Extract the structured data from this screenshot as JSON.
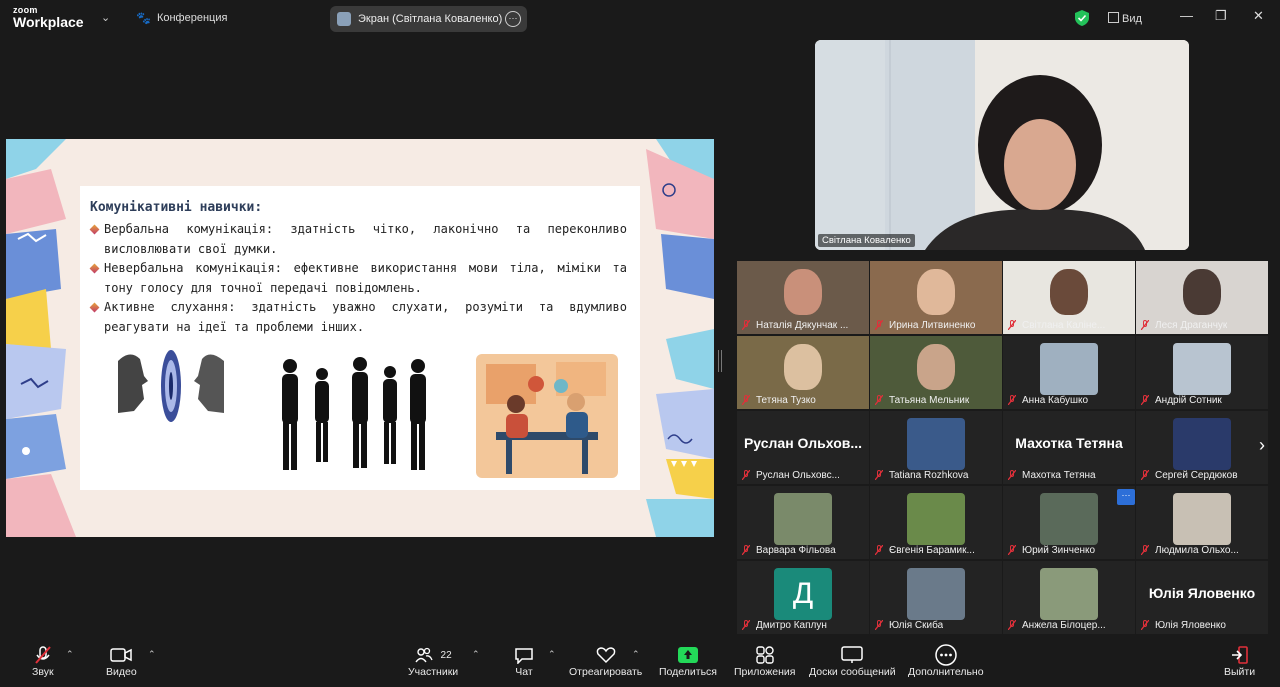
{
  "app": {
    "logo_top": "zoom",
    "logo_bottom": "Workplace",
    "meeting_label": "Конференция",
    "share_pill": "Экран (Світлана Коваленко)",
    "view_label": "Вид",
    "window_controls": [
      "—",
      "❐",
      "✕"
    ]
  },
  "slide": {
    "title": "Комунікативні навички:",
    "bullets": [
      "Вербальна комунікація: здатність чітко, лаконічно та переконливо висловлювати свої думки.",
      "Невербальна комунікація: ефективне використання мови тіла, міміки та тону голосу для точної передачі повідомлень.",
      "Активне слухання: здатність уважно слухати, розуміти та вдумливо реагувати на ідеї та проблеми інших."
    ]
  },
  "active_speaker": {
    "name": "Світлана Коваленко"
  },
  "participants": [
    {
      "name": "Наталія Дякунчак ...",
      "kind": "video",
      "bg": "#6b5a4a",
      "face": "#c9907a"
    },
    {
      "name": "Ирина Литвиненко",
      "kind": "video",
      "bg": "#8a6a4e",
      "face": "#e0b89a"
    },
    {
      "name": "Світлана Каліне...",
      "kind": "video",
      "bg": "#e8e6e0",
      "face": "#6a4a3a"
    },
    {
      "name": "Леся Драганчук",
      "kind": "video",
      "bg": "#d8d4d0",
      "face": "#4a3a34"
    },
    {
      "name": "Тетяна Тузко",
      "kind": "video",
      "bg": "#7a6a48",
      "face": "#dcc0a0"
    },
    {
      "name": "Татьяна Мельник",
      "kind": "video",
      "bg": "#4e5a3a",
      "face": "#c9a48a"
    },
    {
      "name": "Анна Кабушко",
      "kind": "thumb",
      "bg": "#9fb0c0"
    },
    {
      "name": "Андрій Сотник",
      "kind": "thumb",
      "bg": "#b8c4d0"
    },
    {
      "name": "Руслан Ольховс...",
      "kind": "text",
      "display": "Руслан Ольхов..."
    },
    {
      "name": "Tatiana Rozhkova",
      "kind": "thumb",
      "bg": "#3a5a8a"
    },
    {
      "name": "Махотка Тетяна",
      "kind": "text",
      "display": "Махотка Тетяна"
    },
    {
      "name": "Сергей Сердюков",
      "kind": "thumb",
      "bg": "#2a3a6a"
    },
    {
      "name": "Варвара Фільова",
      "kind": "thumb",
      "bg": "#7a8a6a"
    },
    {
      "name": "Євгенія Барамик...",
      "kind": "thumb",
      "bg": "#6a8a4a"
    },
    {
      "name": "Юрий Зинченко",
      "kind": "thumb",
      "bg": "#5a6a5a"
    },
    {
      "name": "Людмила Ольхо...",
      "kind": "thumb",
      "bg": "#c8c0b4"
    },
    {
      "name": "Дмитро Каплун",
      "kind": "letter",
      "letter": "Д",
      "bg": "#1a8a7a"
    },
    {
      "name": "Юлія Скиба",
      "kind": "thumb",
      "bg": "#6a7a8a"
    },
    {
      "name": "Анжела Білоцер...",
      "kind": "thumb",
      "bg": "#8a9a7a"
    },
    {
      "name": "Юлія Яловенко",
      "kind": "text",
      "display": "Юлія Яловенко"
    }
  ],
  "colors": {
    "accent": "#2d6fd8",
    "share_green": "#23d959",
    "muted_red": "#e0303a"
  },
  "toolbar": {
    "audio": "Звук",
    "video": "Видео",
    "participants": "Участники",
    "participants_count": "22",
    "chat": "Чат",
    "react": "Отреагировать",
    "share": "Поделиться",
    "apps": "Приложения",
    "whiteboards": "Доски сообщений",
    "more": "Дополнительно",
    "leave": "Выйти"
  }
}
